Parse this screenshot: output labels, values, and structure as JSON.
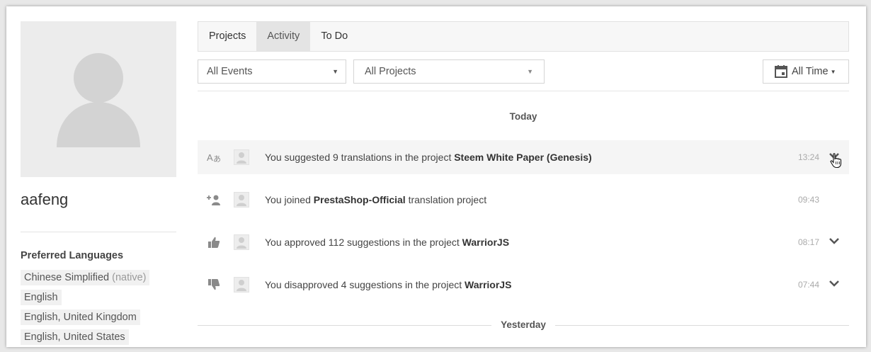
{
  "profile": {
    "username": "aafeng",
    "preferred_languages_title": "Preferred Languages",
    "languages": [
      {
        "name": "Chinese Simplified",
        "note": "(native)"
      },
      {
        "name": "English",
        "note": ""
      },
      {
        "name": "English, United Kingdom",
        "note": ""
      },
      {
        "name": "English, United States",
        "note": ""
      }
    ]
  },
  "tabs": [
    {
      "label": "Projects",
      "active": false
    },
    {
      "label": "Activity",
      "active": true
    },
    {
      "label": "To Do",
      "active": false
    }
  ],
  "filters": {
    "events_value": "All Events",
    "projects_value": "All Projects",
    "time_label": "All Time"
  },
  "days": {
    "today": "Today",
    "yesterday": "Yesterday"
  },
  "activities": [
    {
      "icon": "translate-icon",
      "pre": "You suggested 9 translations in the project ",
      "bold": "Steem White Paper (Genesis)",
      "post": "",
      "time": "13:24",
      "expandable": true,
      "highlighted": true
    },
    {
      "icon": "add-user-icon",
      "pre": "You joined ",
      "bold": "PrestaShop-Official",
      "post": " translation project",
      "time": "09:43",
      "expandable": false,
      "highlighted": false
    },
    {
      "icon": "thumbs-up-icon",
      "pre": "You approved 112 suggestions in the project ",
      "bold": "WarriorJS",
      "post": "",
      "time": "08:17",
      "expandable": true,
      "highlighted": false
    },
    {
      "icon": "thumbs-down-icon",
      "pre": "You disapproved 4 suggestions in the project ",
      "bold": "WarriorJS",
      "post": "",
      "time": "07:44",
      "expandable": true,
      "highlighted": false
    }
  ],
  "colors": {
    "row_highlight": "#f5f5f5",
    "tab_active_bg": "#e4e4e4",
    "muted_icon": "#9a9a9a"
  }
}
